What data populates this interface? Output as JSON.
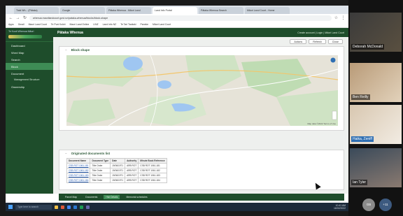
{
  "browser": {
    "tabs": [
      "Tiaki Wh... (Pātaka)",
      "Google",
      "Pātaka Whenua - Māori Land",
      "Land Info Portal",
      "Pātaka Whenua Search",
      "Māori Land Court - Home"
    ],
    "url": "whenua.maorilandcourt.govt.nz/pataka-whenua/blocks/block-shape",
    "bookmarks": [
      "Apps",
      "Gmail",
      "Maori Land Court",
      "Te Puni Kokiri",
      "Maori Land Online",
      "LINZ",
      "Land Info NZ",
      "Te Tari Tautiaki",
      "Paneke",
      "Māori Land Court"
    ]
  },
  "app": {
    "logo_text": "Te Kooti Whenua Māori",
    "title": "Pātaka Whenua",
    "header_right": "Create account  |  Login  |  Māori Land Court",
    "nav": [
      {
        "label": "Dashboard"
      },
      {
        "label": "Word Map"
      },
      {
        "label": "Search"
      },
      {
        "label": "Block"
      },
      {
        "label": "Document"
      },
      {
        "label": "Management Structure"
      },
      {
        "label": "Ownership"
      }
    ],
    "actions": [
      "Actions",
      "Refresh",
      "Close"
    ],
    "block_shape_title": "Block shape",
    "documents_title": "Originated documents list",
    "doc_columns": [
      "Document Name",
      "Document Type",
      "Date",
      "Authority",
      "Minute Book Reference"
    ],
    "doc_rows": [
      [
        "CSB ROT 1061-181",
        "Title Order",
        "19/06/1971",
        "ARB ROT",
        "CSB ROT 1061-181"
      ],
      [
        "CSB ROT 1061-182",
        "Title Order",
        "19/06/1971",
        "ARB ROT",
        "CSB ROT 1061-182"
      ],
      [
        "CSB ROT 1061-183",
        "Title Order",
        "19/06/1971",
        "ARB ROT",
        "CSB ROT 1061-183"
      ],
      [
        "CSB ROT 1061-184",
        "Title Order",
        "19/06/1971",
        "ARB ROT",
        "CSB ROT 1061-184"
      ]
    ],
    "bottom_tabs": [
      "Parcel Map",
      "Documents",
      "Hist Details",
      "Memorial schedules"
    ],
    "map_attribution": "Map data ©2022  Terms of Use"
  },
  "taskbar": {
    "search_placeholder": "Type here to search",
    "time": "10:41 AM",
    "date": "16/02/2022"
  },
  "video": {
    "participants": [
      "Deborah McDonald",
      "Ben Reilly",
      "Haika, Zeniff",
      "Ian Tyler"
    ],
    "controls": [
      "GB",
      "+11"
    ]
  },
  "colors": {
    "brand_green": "#1e4d2b",
    "selected_green": "#3e8c55"
  }
}
